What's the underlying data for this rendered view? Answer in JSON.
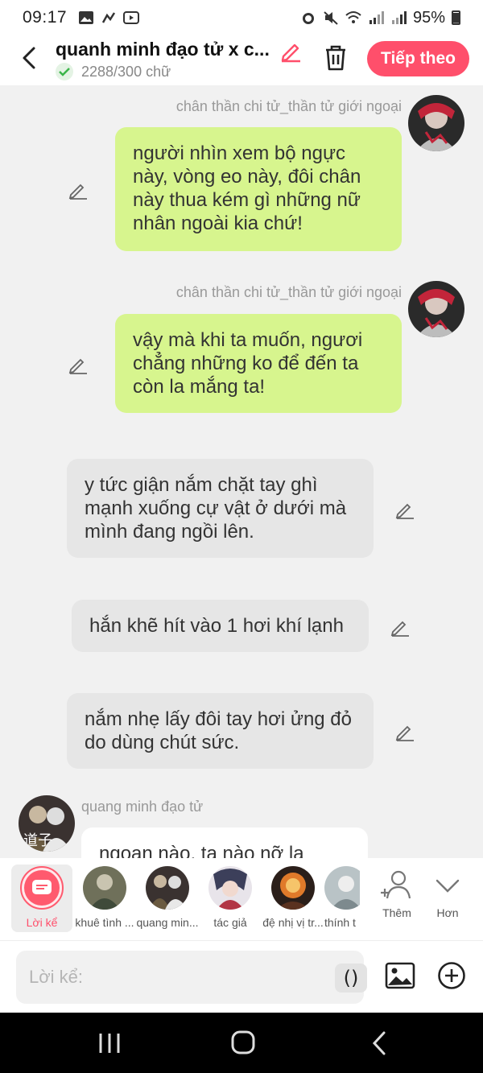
{
  "status_bar": {
    "time": "09:17",
    "battery": "95%"
  },
  "header": {
    "title": "quanh minh đạo tử x c...",
    "word_count": "2288/300 chữ",
    "next_button": "Tiếp theo"
  },
  "messages": [
    {
      "type": "character",
      "sender": "chân thần chi tử_thần tử giới ngoại",
      "text": "người nhìn xem bộ ngực này, vòng eo này, đôi chân này thua kém gì những nữ nhân ngoài kia chứ!"
    },
    {
      "type": "character",
      "sender": "chân thần chi tử_thần tử giới ngoại",
      "text": "vậy mà khi ta muốn, ngươi chẳng những ko để đến ta còn la mắng ta!"
    },
    {
      "type": "narration",
      "text": "y tức giận nắm chặt tay ghì mạnh xuống cự vật ở dưới mà mình đang ngồi lên."
    },
    {
      "type": "narration",
      "text": "hắn khẽ hít vào 1 hơi khí lạnh"
    },
    {
      "type": "narration",
      "text": "nắm nhẹ lấy đôi tay hơi ửng đỏ do dùng chút sức."
    },
    {
      "type": "other",
      "sender": "quang minh đạo tử",
      "text": "ngoan nào, ta nào nỡ la"
    }
  ],
  "characters": [
    {
      "label": "Lời kể",
      "selected": true
    },
    {
      "label": "khuê tình ..."
    },
    {
      "label": "quang min..."
    },
    {
      "label": "tác giả"
    },
    {
      "label": "đệ nhị vị tr..."
    },
    {
      "label": "thính t"
    }
  ],
  "char_actions": {
    "add": "Thêm",
    "more": "Hơn"
  },
  "input": {
    "placeholder": "Lời kể:",
    "paren_button": "()"
  },
  "colors": {
    "accent": "#ff4f6b",
    "green_bubble": "#d7f58e",
    "gray_bubble": "#e6e6e6"
  }
}
